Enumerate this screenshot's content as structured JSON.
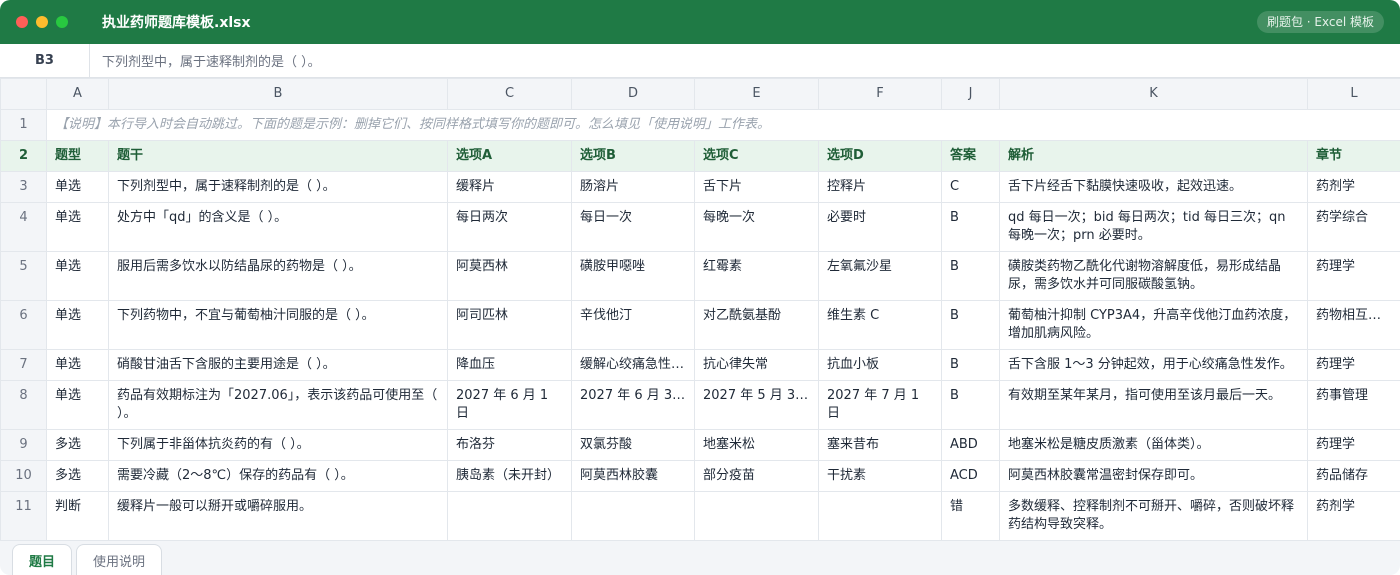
{
  "window": {
    "title": "执业药师题库模板.xlsx",
    "badge": "刷题包 · Excel 模板",
    "colors": {
      "titlebar": "#1f7a45",
      "close": "#ff5f57",
      "minimize": "#febc2e",
      "maximize": "#28c840"
    }
  },
  "formula_bar": {
    "cell_ref": "B3",
    "content": "下列剂型中，属于速释制剂的是（ ）。"
  },
  "columns": [
    "A",
    "B",
    "C",
    "D",
    "E",
    "F",
    "J",
    "K",
    "L"
  ],
  "note_row": {
    "num": "1",
    "text": "【说明】本行导入时会自动跳过。下面的题是示例：删掉它们、按同样格式填写你的题即可。怎么填见「使用说明」工作表。"
  },
  "header_row": {
    "num": "2",
    "cells": [
      "题型",
      "题干",
      "选项A",
      "选项B",
      "选项C",
      "选项D",
      "答案",
      "解析",
      "章节"
    ]
  },
  "rows": [
    {
      "num": "3",
      "cells": [
        "单选",
        "下列剂型中，属于速释制剂的是（ ）。",
        "缓释片",
        "肠溶片",
        "舌下片",
        "控释片",
        "C",
        "舌下片经舌下黏膜快速吸收，起效迅速。",
        "药剂学"
      ]
    },
    {
      "num": "4",
      "cells": [
        "单选",
        "处方中「qd」的含义是（ ）。",
        "每日两次",
        "每日一次",
        "每晚一次",
        "必要时",
        "B",
        "qd 每日一次；bid 每日两次；tid 每日三次；qn 每晚一次；prn 必要时。",
        "药学综合"
      ]
    },
    {
      "num": "5",
      "cells": [
        "单选",
        "服用后需多饮水以防结晶尿的药物是（ ）。",
        "阿莫西林",
        "磺胺甲噁唑",
        "红霉素",
        "左氧氟沙星",
        "B",
        "磺胺类药物乙酰化代谢物溶解度低，易形成结晶尿，需多饮水并可同服碳酸氢钠。",
        "药理学"
      ]
    },
    {
      "num": "6",
      "cells": [
        "单选",
        "下列药物中，不宜与葡萄柚汁同服的是（ ）。",
        "阿司匹林",
        "辛伐他汀",
        "对乙酰氨基酚",
        "维生素 C",
        "B",
        "葡萄柚汁抑制 CYP3A4，升高辛伐他汀血药浓度，增加肌病风险。",
        "药物相互作用"
      ]
    },
    {
      "num": "7",
      "cells": [
        "单选",
        "硝酸甘油舌下含服的主要用途是（ ）。",
        "降血压",
        "缓解心绞痛急性发作",
        "抗心律失常",
        "抗血小板",
        "B",
        "舌下含服 1～3 分钟起效，用于心绞痛急性发作。",
        "药理学"
      ]
    },
    {
      "num": "8",
      "cells": [
        "单选",
        "药品有效期标注为「2027.06」，表示该药品可使用至（ ）。",
        "2027 年 6 月 1 日",
        "2027 年 6 月 30 日",
        "2027 年 5 月 31 日",
        "2027 年 7 月 1 日",
        "B",
        "有效期至某年某月，指可使用至该月最后一天。",
        "药事管理"
      ]
    },
    {
      "num": "9",
      "cells": [
        "多选",
        "下列属于非甾体抗炎药的有（ ）。",
        "布洛芬",
        "双氯芬酸",
        "地塞米松",
        "塞来昔布",
        "ABD",
        "地塞米松是糖皮质激素（甾体类）。",
        "药理学"
      ]
    },
    {
      "num": "10",
      "cells": [
        "多选",
        "需要冷藏（2～8℃）保存的药品有（ ）。",
        "胰岛素（未开封）",
        "阿莫西林胶囊",
        "部分疫苗",
        "干扰素",
        "ACD",
        "阿莫西林胶囊常温密封保存即可。",
        "药品储存"
      ]
    },
    {
      "num": "11",
      "cells": [
        "判断",
        "缓释片一般可以掰开或嚼碎服用。",
        "",
        "",
        "",
        "",
        "错",
        "多数缓释、控释制剂不可掰开、嚼碎，否则破坏释药结构导致突释。",
        "药剂学"
      ]
    }
  ],
  "sheet_tabs": [
    {
      "label": "题目",
      "active": true
    },
    {
      "label": "使用说明",
      "active": false
    }
  ]
}
